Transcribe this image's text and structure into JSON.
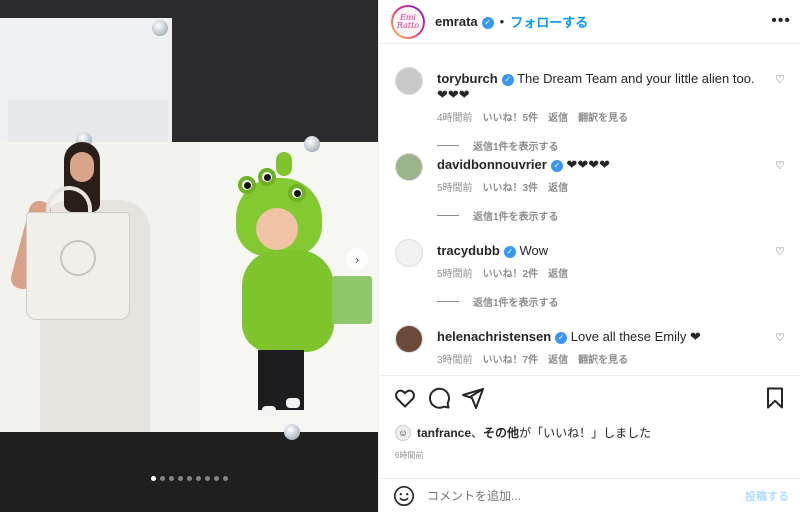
{
  "header": {
    "avatar_text": "Emi Ratto",
    "username": "emrata",
    "separator": "•",
    "follow_label": "フォローする",
    "more_label": "•••"
  },
  "carousel": {
    "dot_count": 9,
    "active_index": 0,
    "next_label": "›"
  },
  "comments": [
    {
      "username": "toryburch",
      "verified": true,
      "text": "The Dream Team and your little alien too. ❤❤❤",
      "time": "4時間前",
      "likes": "いいね！5件",
      "reply": "返信",
      "translate": "翻訳を見る",
      "view_replies": "返信1件を表示する",
      "avatar_color": "#c9c9c9"
    },
    {
      "username": "davidbonnouvrier",
      "verified": true,
      "text": "❤❤❤❤",
      "time": "5時間前",
      "likes": "いいね！3件",
      "reply": "返信",
      "translate": "",
      "view_replies": "返信1件を表示する",
      "avatar_color": "#9db38c"
    },
    {
      "username": "tracydubb",
      "verified": true,
      "text": "Wow",
      "time": "5時間前",
      "likes": "いいね！2件",
      "reply": "返信",
      "translate": "",
      "view_replies": "返信1件を表示する",
      "avatar_color": "#f2f2f2"
    },
    {
      "username": "helenachristensen",
      "verified": true,
      "text": "Love all these Emily ❤",
      "time": "3時間前",
      "likes": "いいね！7件",
      "reply": "返信",
      "translate": "翻訳を見る",
      "view_replies": "",
      "avatar_color": "#6b4a3a"
    }
  ],
  "liked_by": {
    "user": "tanfrance",
    "sep": "、",
    "others": "その他",
    "suffix": "が「いいね！」しました"
  },
  "post_time": "6時間前",
  "comment_box": {
    "placeholder": "コメントを追加...",
    "post_label": "投稿する"
  },
  "colors": {
    "accent": "#0095f6",
    "verified": "#3897f0",
    "muted": "#8e8e8e",
    "costume_green": "#7ec42c"
  },
  "icons": [
    "heart-icon",
    "comment-icon",
    "share-icon",
    "bookmark-icon",
    "smile-icon",
    "verified-badge-icon",
    "more-icon"
  ]
}
